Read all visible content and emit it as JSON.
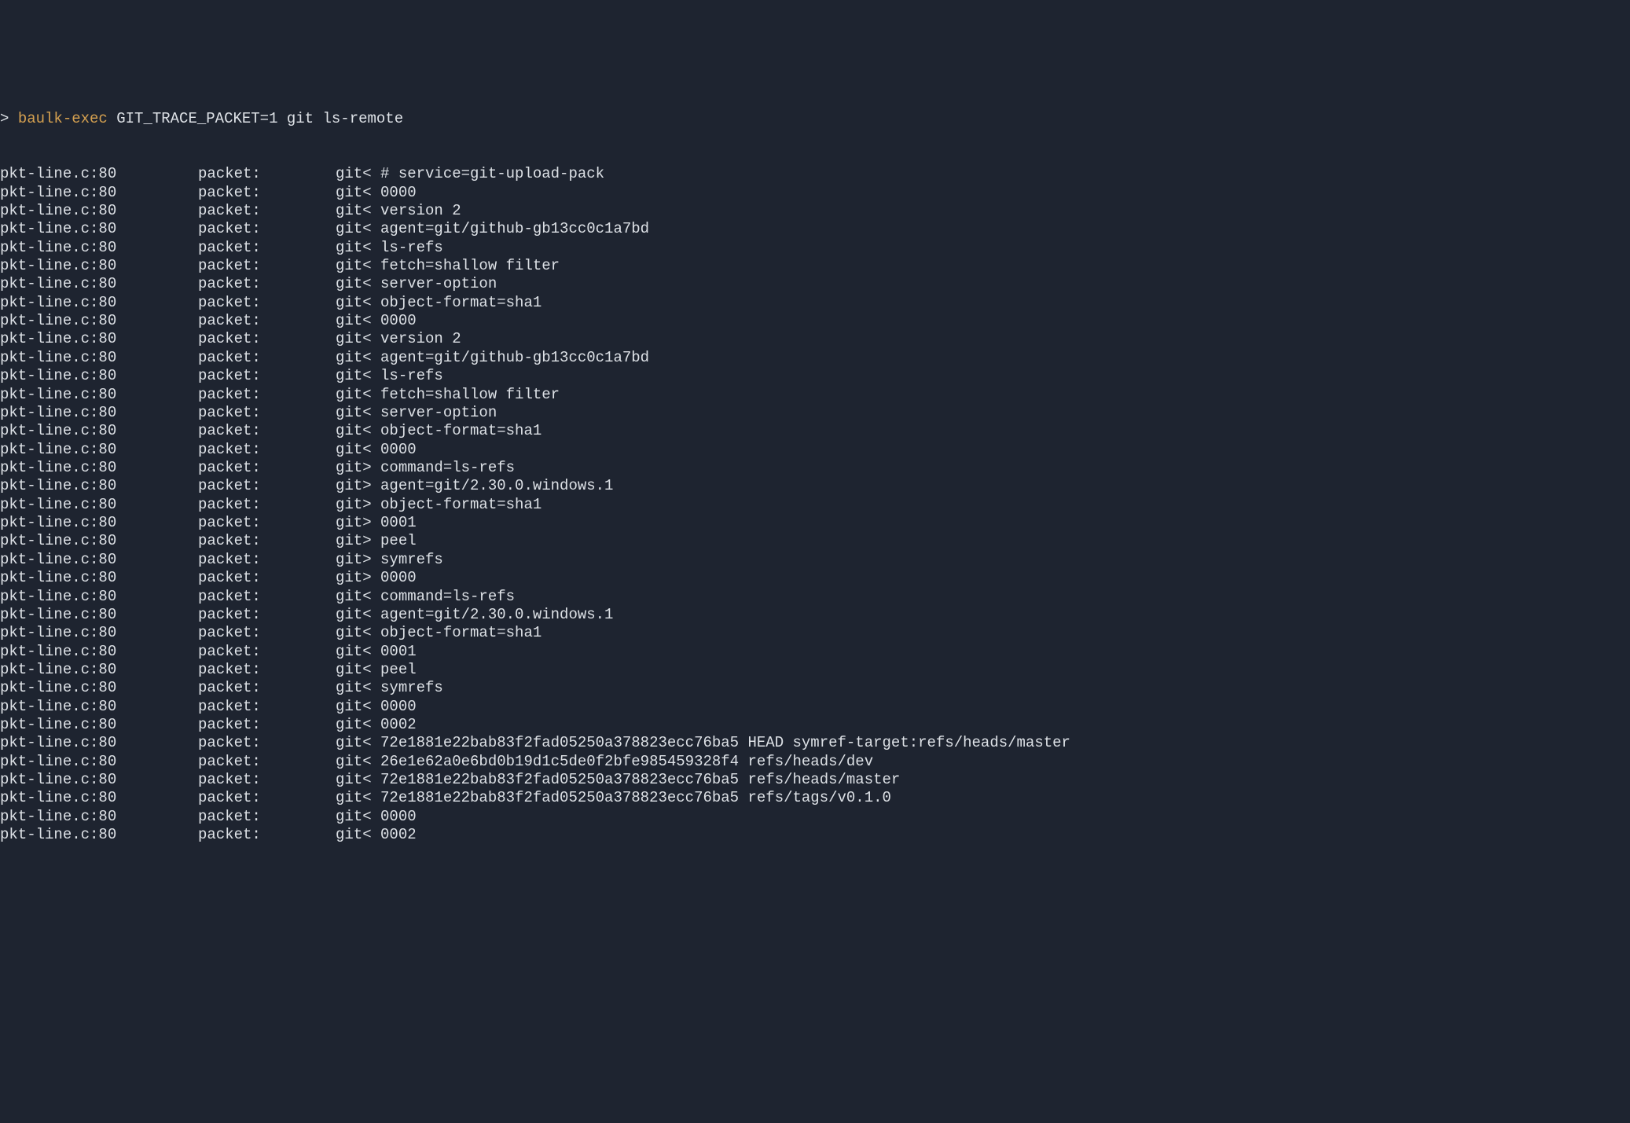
{
  "prompt": {
    "symbol": "> ",
    "exec": "baulk-exec",
    "args": " GIT_TRACE_PACKET=1 git ls-remote"
  },
  "trace": [
    {
      "src": "pkt-line.c:80",
      "label": "packet:",
      "content": "git< # service=git-upload-pack"
    },
    {
      "src": "pkt-line.c:80",
      "label": "packet:",
      "content": "git< 0000"
    },
    {
      "src": "pkt-line.c:80",
      "label": "packet:",
      "content": "git< version 2"
    },
    {
      "src": "pkt-line.c:80",
      "label": "packet:",
      "content": "git< agent=git/github-gb13cc0c1a7bd"
    },
    {
      "src": "pkt-line.c:80",
      "label": "packet:",
      "content": "git< ls-refs"
    },
    {
      "src": "pkt-line.c:80",
      "label": "packet:",
      "content": "git< fetch=shallow filter"
    },
    {
      "src": "pkt-line.c:80",
      "label": "packet:",
      "content": "git< server-option"
    },
    {
      "src": "pkt-line.c:80",
      "label": "packet:",
      "content": "git< object-format=sha1"
    },
    {
      "src": "pkt-line.c:80",
      "label": "packet:",
      "content": "git< 0000"
    },
    {
      "src": "pkt-line.c:80",
      "label": "packet:",
      "content": "git< version 2"
    },
    {
      "src": "pkt-line.c:80",
      "label": "packet:",
      "content": "git< agent=git/github-gb13cc0c1a7bd"
    },
    {
      "src": "pkt-line.c:80",
      "label": "packet:",
      "content": "git< ls-refs"
    },
    {
      "src": "pkt-line.c:80",
      "label": "packet:",
      "content": "git< fetch=shallow filter"
    },
    {
      "src": "pkt-line.c:80",
      "label": "packet:",
      "content": "git< server-option"
    },
    {
      "src": "pkt-line.c:80",
      "label": "packet:",
      "content": "git< object-format=sha1"
    },
    {
      "src": "pkt-line.c:80",
      "label": "packet:",
      "content": "git< 0000"
    },
    {
      "src": "pkt-line.c:80",
      "label": "packet:",
      "content": "git> command=ls-refs"
    },
    {
      "src": "pkt-line.c:80",
      "label": "packet:",
      "content": "git> agent=git/2.30.0.windows.1"
    },
    {
      "src": "pkt-line.c:80",
      "label": "packet:",
      "content": "git> object-format=sha1"
    },
    {
      "src": "pkt-line.c:80",
      "label": "packet:",
      "content": "git> 0001"
    },
    {
      "src": "pkt-line.c:80",
      "label": "packet:",
      "content": "git> peel"
    },
    {
      "src": "pkt-line.c:80",
      "label": "packet:",
      "content": "git> symrefs"
    },
    {
      "src": "pkt-line.c:80",
      "label": "packet:",
      "content": "git> 0000"
    },
    {
      "src": "pkt-line.c:80",
      "label": "packet:",
      "content": "git< command=ls-refs"
    },
    {
      "src": "pkt-line.c:80",
      "label": "packet:",
      "content": "git< agent=git/2.30.0.windows.1"
    },
    {
      "src": "pkt-line.c:80",
      "label": "packet:",
      "content": "git< object-format=sha1"
    },
    {
      "src": "pkt-line.c:80",
      "label": "packet:",
      "content": "git< 0001"
    },
    {
      "src": "pkt-line.c:80",
      "label": "packet:",
      "content": "git< peel"
    },
    {
      "src": "pkt-line.c:80",
      "label": "packet:",
      "content": "git< symrefs"
    },
    {
      "src": "pkt-line.c:80",
      "label": "packet:",
      "content": "git< 0000"
    },
    {
      "src": "pkt-line.c:80",
      "label": "packet:",
      "content": "git< 0002"
    },
    {
      "src": "pkt-line.c:80",
      "label": "packet:",
      "content": "git< 72e1881e22bab83f2fad05250a378823ecc76ba5 HEAD symref-target:refs/heads/master"
    },
    {
      "src": "pkt-line.c:80",
      "label": "packet:",
      "content": "git< 26e1e62a0e6bd0b19d1c5de0f2bfe985459328f4 refs/heads/dev"
    },
    {
      "src": "pkt-line.c:80",
      "label": "packet:",
      "content": "git< 72e1881e22bab83f2fad05250a378823ecc76ba5 refs/heads/master"
    },
    {
      "src": "pkt-line.c:80",
      "label": "packet:",
      "content": "git< 72e1881e22bab83f2fad05250a378823ecc76ba5 refs/tags/v0.1.0"
    },
    {
      "src": "pkt-line.c:80",
      "label": "packet:",
      "content": "git< 0000"
    },
    {
      "src": "pkt-line.c:80",
      "label": "packet:",
      "content": "git< 0002"
    }
  ]
}
